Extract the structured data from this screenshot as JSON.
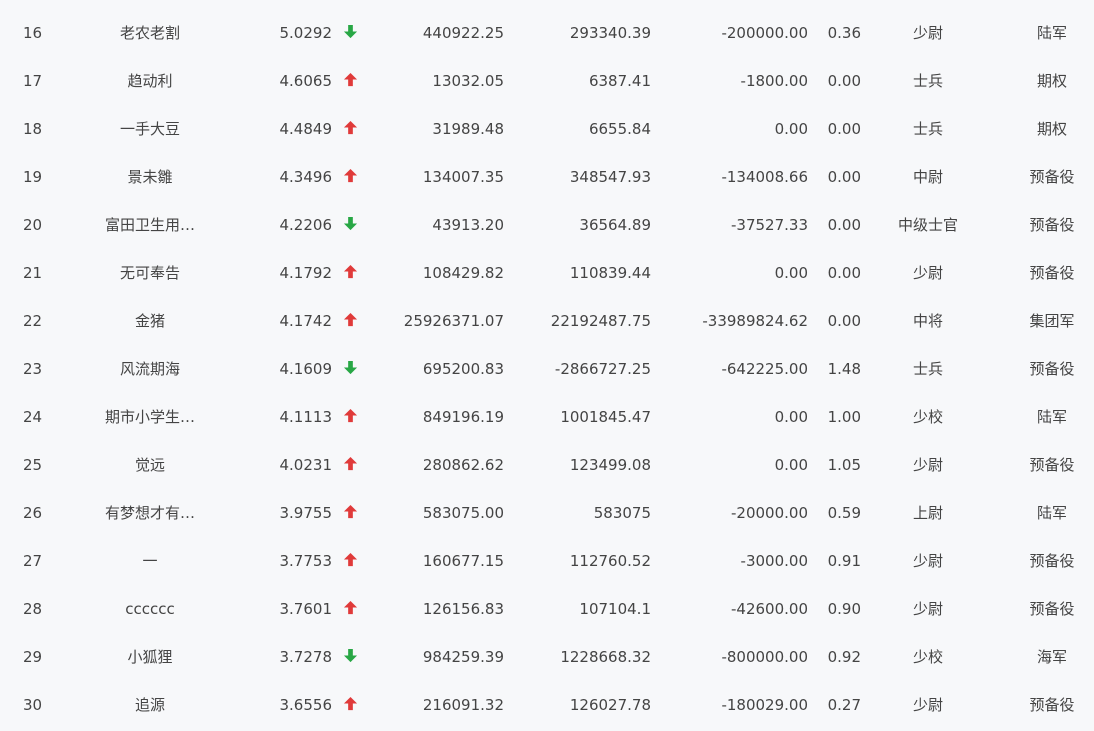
{
  "colors": {
    "background": "#f7f8fa",
    "text": "#444444",
    "up": "#e03a3a",
    "down": "#28a745"
  },
  "icons": {
    "up": "up-arrow-icon",
    "down": "down-arrow-icon"
  },
  "rows": [
    {
      "rank": "16",
      "name": "老农老割",
      "score": "5.0292",
      "trend": "down",
      "v1": "440922.25",
      "v2": "293340.39",
      "v3": "-200000.00",
      "v4": "0.36",
      "rank_title": "少尉",
      "branch": "陆军"
    },
    {
      "rank": "17",
      "name": "趋动利",
      "score": "4.6065",
      "trend": "up",
      "v1": "13032.05",
      "v2": "6387.41",
      "v3": "-1800.00",
      "v4": "0.00",
      "rank_title": "士兵",
      "branch": "期权"
    },
    {
      "rank": "18",
      "name": "一手大豆",
      "score": "4.4849",
      "trend": "up",
      "v1": "31989.48",
      "v2": "6655.84",
      "v3": "0.00",
      "v4": "0.00",
      "rank_title": "士兵",
      "branch": "期权"
    },
    {
      "rank": "19",
      "name": "景未雛",
      "score": "4.3496",
      "trend": "up",
      "v1": "134007.35",
      "v2": "348547.93",
      "v3": "-134008.66",
      "v4": "0.00",
      "rank_title": "中尉",
      "branch": "预备役"
    },
    {
      "rank": "20",
      "name": "富田卫生用…",
      "score": "4.2206",
      "trend": "down",
      "v1": "43913.20",
      "v2": "36564.89",
      "v3": "-37527.33",
      "v4": "0.00",
      "rank_title": "中级士官",
      "branch": "预备役"
    },
    {
      "rank": "21",
      "name": "无可奉告",
      "score": "4.1792",
      "trend": "up",
      "v1": "108429.82",
      "v2": "110839.44",
      "v3": "0.00",
      "v4": "0.00",
      "rank_title": "少尉",
      "branch": "预备役"
    },
    {
      "rank": "22",
      "name": "金猪",
      "score": "4.1742",
      "trend": "up",
      "v1": "25926371.07",
      "v2": "22192487.75",
      "v3": "-33989824.62",
      "v4": "0.00",
      "rank_title": "中将",
      "branch": "集团军"
    },
    {
      "rank": "23",
      "name": "风流期海",
      "score": "4.1609",
      "trend": "down",
      "v1": "695200.83",
      "v2": "-2866727.25",
      "v3": "-642225.00",
      "v4": "1.48",
      "rank_title": "士兵",
      "branch": "预备役"
    },
    {
      "rank": "24",
      "name": "期市小学生…",
      "score": "4.1113",
      "trend": "up",
      "v1": "849196.19",
      "v2": "1001845.47",
      "v3": "0.00",
      "v4": "1.00",
      "rank_title": "少校",
      "branch": "陆军"
    },
    {
      "rank": "25",
      "name": "觉远",
      "score": "4.0231",
      "trend": "up",
      "v1": "280862.62",
      "v2": "123499.08",
      "v3": "0.00",
      "v4": "1.05",
      "rank_title": "少尉",
      "branch": "预备役"
    },
    {
      "rank": "26",
      "name": "有梦想才有…",
      "score": "3.9755",
      "trend": "up",
      "v1": "583075.00",
      "v2": "583075",
      "v3": "-20000.00",
      "v4": "0.59",
      "rank_title": "上尉",
      "branch": "陆军"
    },
    {
      "rank": "27",
      "name": "一",
      "score": "3.7753",
      "trend": "up",
      "v1": "160677.15",
      "v2": "112760.52",
      "v3": "-3000.00",
      "v4": "0.91",
      "rank_title": "少尉",
      "branch": "预备役"
    },
    {
      "rank": "28",
      "name": "cccccc",
      "score": "3.7601",
      "trend": "up",
      "v1": "126156.83",
      "v2": "107104.1",
      "v3": "-42600.00",
      "v4": "0.90",
      "rank_title": "少尉",
      "branch": "预备役"
    },
    {
      "rank": "29",
      "name": "小狐狸",
      "score": "3.7278",
      "trend": "down",
      "v1": "984259.39",
      "v2": "1228668.32",
      "v3": "-800000.00",
      "v4": "0.92",
      "rank_title": "少校",
      "branch": "海军"
    },
    {
      "rank": "30",
      "name": "追源",
      "score": "3.6556",
      "trend": "up",
      "v1": "216091.32",
      "v2": "126027.78",
      "v3": "-180029.00",
      "v4": "0.27",
      "rank_title": "少尉",
      "branch": "预备役"
    }
  ]
}
